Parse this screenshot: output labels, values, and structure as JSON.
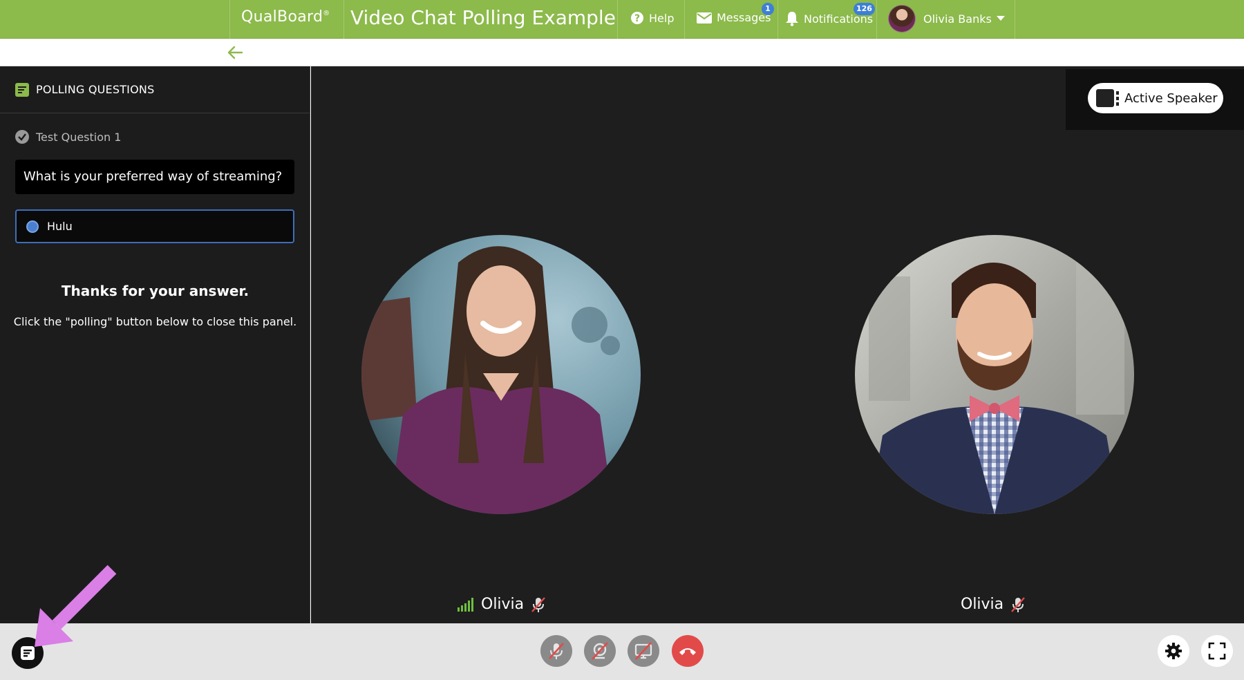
{
  "header": {
    "brand": "QualBoard",
    "brand_mark": "®",
    "title": "Video Chat Polling Example",
    "help_label": "Help",
    "messages_label": "Messages",
    "messages_count": "1",
    "notifications_label": "Notifications",
    "notifications_count": "126",
    "user_name": "Olivia Banks"
  },
  "panel": {
    "header": "POLLING QUESTIONS",
    "question_name": "Test Question 1",
    "question_text": "What is your preferred way of streaming?",
    "selected_answer": "Hulu",
    "thanks": "Thanks for your answer.",
    "instructions": "Click the \"polling\" button below to close this panel."
  },
  "stage": {
    "active_speaker_label": "Active Speaker",
    "participants": [
      {
        "name": "Olivia"
      },
      {
        "name": "Olivia"
      }
    ]
  },
  "colors": {
    "brand_green": "#8cba4b",
    "badge_blue": "#3e7fd6",
    "hangup_red": "#e24a4a",
    "annotation_arrow": "#d97fe6"
  },
  "icons": {
    "help": "question-circle-icon",
    "messages": "envelope-icon",
    "notifications": "bell-icon",
    "back": "arrow-left-icon",
    "polling": "poll-icon",
    "settings": "gear-icon",
    "fullscreen": "fullscreen-icon"
  }
}
